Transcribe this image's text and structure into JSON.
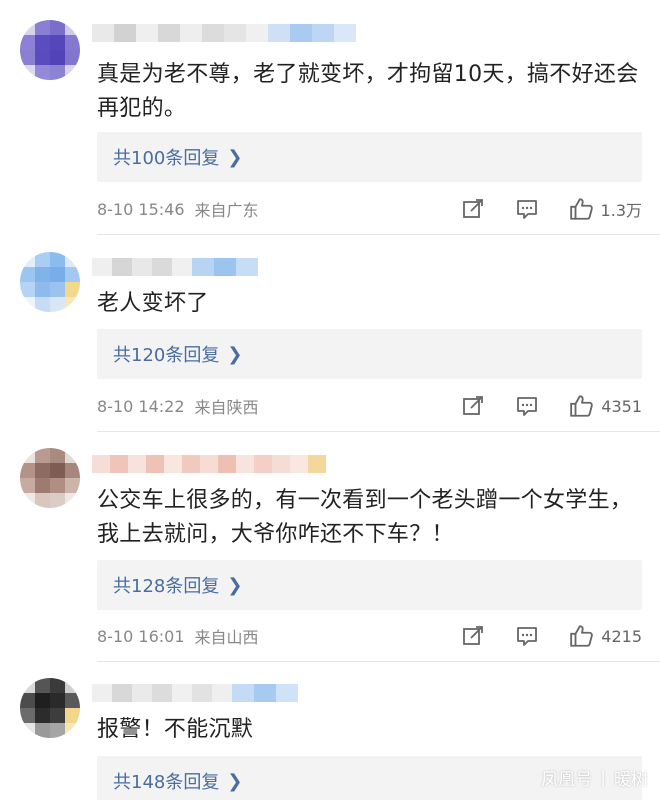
{
  "comments": [
    {
      "text": "真是为老不尊，老了就变坏，才拘留10天，搞不好还会再犯的。",
      "replies_label": "共100条回复",
      "date": "8-10 15:46",
      "location": "来自广东",
      "likes": "1.3万"
    },
    {
      "text": "老人变坏了",
      "replies_label": "共120条回复",
      "date": "8-10 14:22",
      "location": "来自陕西",
      "likes": "4351"
    },
    {
      "text": "公交车上很多的，有一次看到一个老头蹭一个女学生，我上去就问，大爷你咋还不下车？！",
      "replies_label": "共128条回复",
      "date": "8-10 16:01",
      "location": "来自山西",
      "likes": "4215"
    },
    {
      "text": "报警！不能沉默",
      "replies_label": "共148条回复"
    }
  ],
  "icons": {
    "chevron": "chevron-right-icon",
    "share": "share-edit-icon",
    "comment": "comment-icon",
    "like": "thumbs-up-icon"
  },
  "watermark": {
    "source": "凤凰号",
    "separator": "|",
    "author": "暖树"
  },
  "colors": {
    "link": "#4a6da0",
    "reply_bg": "#f3f3f3",
    "meta": "#888888"
  }
}
